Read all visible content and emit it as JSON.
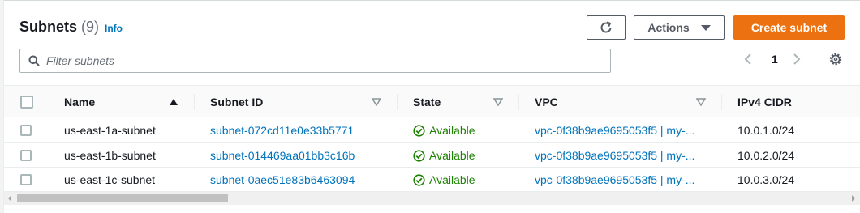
{
  "header": {
    "title": "Subnets",
    "count": "(9)",
    "info_label": "Info"
  },
  "toolbar": {
    "actions_label": "Actions",
    "create_label": "Create subnet"
  },
  "filter": {
    "placeholder": "Filter subnets"
  },
  "pagination": {
    "current_page": "1"
  },
  "table": {
    "columns": [
      "Name",
      "Subnet ID",
      "State",
      "VPC",
      "IPv4 CIDR"
    ],
    "rows": [
      {
        "name": "us-east-1a-subnet",
        "subnet_id": "subnet-072cd11e0e33b5771",
        "state": "Available",
        "vpc": "vpc-0f38b9ae9695053f5 | my-...",
        "cidr": "10.0.1.0/24"
      },
      {
        "name": "us-east-1b-subnet",
        "subnet_id": "subnet-014469aa01bb3c16b",
        "state": "Available",
        "vpc": "vpc-0f38b9ae9695053f5 | my-...",
        "cidr": "10.0.2.0/24"
      },
      {
        "name": "us-east-1c-subnet",
        "subnet_id": "subnet-0aec51e83b6463094",
        "state": "Available",
        "vpc": "vpc-0f38b9ae9695053f5 | my-...",
        "cidr": "10.0.3.0/24"
      }
    ]
  },
  "colors": {
    "accent": "#ec7211",
    "link": "#0073bb",
    "success": "#1d8102"
  }
}
